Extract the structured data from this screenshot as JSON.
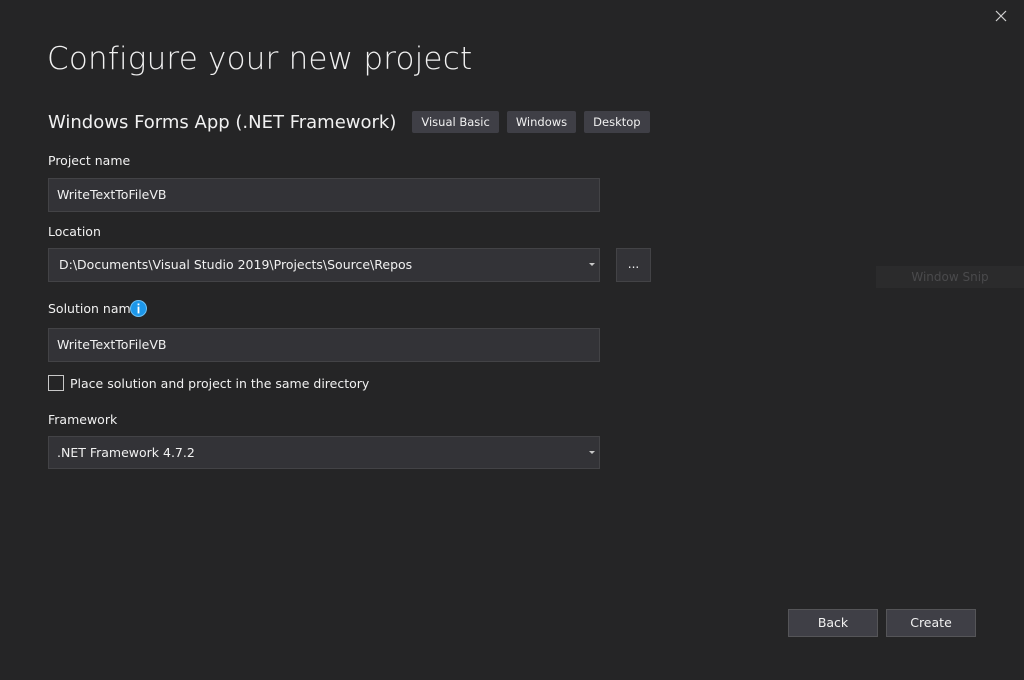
{
  "dialog": {
    "title": "Configure your new project"
  },
  "template": {
    "name": "Windows Forms App (.NET Framework)",
    "tags": [
      "Visual Basic",
      "Windows",
      "Desktop"
    ]
  },
  "project_name": {
    "label": "Project name",
    "value": "WriteTextToFileVB"
  },
  "location": {
    "label": "Location",
    "value": "D:\\Documents\\Visual Studio 2019\\Projects\\Source\\Repos",
    "browse_label": "..."
  },
  "solution_name": {
    "label": "Solution name",
    "value": "WriteTextToFileVB"
  },
  "same_directory": {
    "label": "Place solution and project in the same directory",
    "checked": false
  },
  "framework": {
    "label": "Framework",
    "value": ".NET Framework 4.7.2"
  },
  "overlay": {
    "snip_label": "Window Snip"
  },
  "buttons": {
    "back": "Back",
    "create": "Create"
  },
  "icons": {
    "close": "close-icon",
    "info": "info-icon",
    "dropdown": "chevron-down-icon"
  },
  "colors": {
    "background": "#252526",
    "field": "#333337",
    "tag": "#3f3f46",
    "info_accent": "#1c97ea"
  }
}
